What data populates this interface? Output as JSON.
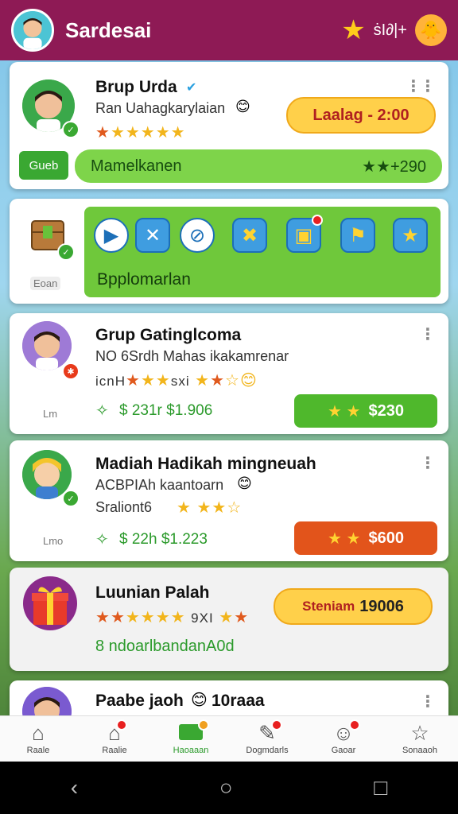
{
  "header": {
    "title": "Sardesai",
    "count": "ṡI∂|+",
    "star_icon": "star-icon",
    "mascot_icon": "mascot-icon"
  },
  "card1": {
    "name": "Brup Urda",
    "subtitle": "Ran Uahagkarylaian",
    "timer": "Laalag - 2:00",
    "tag": "Gueb",
    "bar_label": "Mamelkanen",
    "bar_value": "★★+290"
  },
  "card2": {
    "tag": "Eoan",
    "panel_label": "Bpplomarlan"
  },
  "card3": {
    "name": "Grup Gatinglcoma",
    "subtitle": "NO 6Srdh Mahas ikakamrenar",
    "stars_text": "icnH",
    "stars_mid": "sxi",
    "tag": "Lm",
    "money": "$ 231r $1.906",
    "pill": "$230"
  },
  "card4": {
    "name": "Madiah Hadikah mingneuah",
    "subtitle": "ACBPIAh kaantoarn",
    "line3": "Sraliont6",
    "tag": "Lmo",
    "money": "$ 22h $1.223",
    "pill": "$600"
  },
  "card5": {
    "name": "Luunian Palah",
    "stars_mid": "9XI",
    "pill_label": "Steniam",
    "pill_value": "19006",
    "line3": "8 ndoarlbandanA0d"
  },
  "card6": {
    "name": "Paabe jaoh",
    "suffix": "10raaa"
  },
  "nav": {
    "items": [
      {
        "label": "Raale",
        "icon": "home-icon"
      },
      {
        "label": "Raalie",
        "icon": "house-icon"
      },
      {
        "label": "Haoaaan",
        "icon": "game-icon"
      },
      {
        "label": "Dogmdarls",
        "icon": "edit-icon"
      },
      {
        "label": "Gaoar",
        "icon": "chat-icon"
      },
      {
        "label": "Sonaaoh",
        "icon": "star-icon"
      }
    ]
  },
  "colors": {
    "header": "#8e1a55",
    "green": "#4fb82c",
    "orange": "#e2541b",
    "yellow": "#ffd04a"
  }
}
